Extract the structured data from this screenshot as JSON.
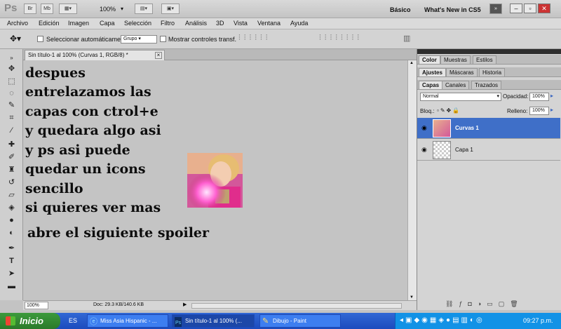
{
  "app": {
    "logo": "Ps",
    "zoom": "100%",
    "workspace": "Básico",
    "whats_new": "What's New in CS5",
    "toolbar_buttons": [
      "Br",
      "Mb"
    ]
  },
  "menu": [
    "Archivo",
    "Edición",
    "Imagen",
    "Capa",
    "Selección",
    "Filtro",
    "Análisis",
    "3D",
    "Vista",
    "Ventana",
    "Ayuda"
  ],
  "options": {
    "auto_select_label": "Seleccionar automáticamente:",
    "auto_select_value": "Grupo",
    "transform_label": "Mostrar controles transf."
  },
  "document": {
    "tab_title": "Sin título-1 al 100% (Curvas 1, RGB/8) *",
    "text_lines": [
      "despues",
      "entrelazamos las",
      "capas con ctrol+e",
      "y quedara algo asi",
      "y ps asi puede",
      "quedar un icons",
      "sencillo",
      "si quieres ver mas",
      "abre el siguiente spoiler"
    ]
  },
  "status": {
    "zoom": "100%",
    "doc": "Doc: 29.3 KB/140.6 KB"
  },
  "panels": {
    "top_tabs": [
      "Color",
      "Muestras",
      "Estilos"
    ],
    "mid_tabs": [
      "Ajustes",
      "Máscaras",
      "Historia"
    ],
    "layer_tabs": [
      "Capas",
      "Canales",
      "Trazados"
    ],
    "blend_mode": "Normal",
    "opacity_label": "Opacidad:",
    "opacity_value": "100%",
    "lock_label": "Bloq.:",
    "fill_label": "Relleno:",
    "fill_value": "100%",
    "layers": [
      {
        "name": "Curvas 1",
        "selected": true
      },
      {
        "name": "Capa 1",
        "selected": false
      }
    ]
  },
  "taskbar": {
    "start": "Inicio",
    "lang": "ES",
    "tasks": [
      {
        "label": "Miss Asia Hispanic - ...",
        "active": false
      },
      {
        "label": "Sin título-1 al 100% (...",
        "active": true
      },
      {
        "label": "Dibujo - Paint",
        "active": false
      }
    ],
    "clock": "09:27 p.m."
  },
  "colors": {
    "selected_layer": "#3f6fc8",
    "taskbar": "#2458c6",
    "start_button": "#35913a"
  }
}
